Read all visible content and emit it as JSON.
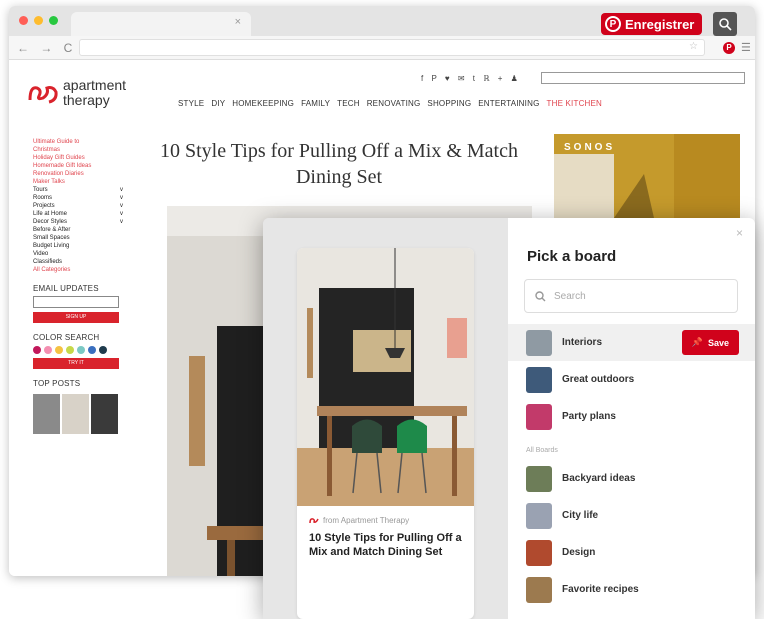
{
  "browser": {
    "tab_close": "×",
    "pinterest_button": "Enregistrer",
    "pinterest_glyph": "P",
    "nav_glyphs": "← → C"
  },
  "site": {
    "logo_line1": "apartment",
    "logo_line2": "therapy",
    "social_icons": "f P ♥ ✉ t ℝ +  ♟",
    "nav": [
      "STYLE",
      "DIY",
      "HOMEKEEPING",
      "FAMILY",
      "TECH",
      "RENOVATING",
      "SHOPPING",
      "ENTERTAINING",
      "THE KITCHEN"
    ],
    "sidebar_links": [
      "Ultimate Guide to",
      "Christmas",
      "Holiday Gift Guides",
      "Homemade Gift Ideas",
      "Renovation Diaries",
      "Maker Talks"
    ],
    "sidebar_items": [
      {
        "label": "Tours",
        "arrow": "v"
      },
      {
        "label": "Rooms",
        "arrow": "v"
      },
      {
        "label": "Projects",
        "arrow": "v"
      },
      {
        "label": "Life at Home",
        "arrow": "v"
      },
      {
        "label": "Decor Styles",
        "arrow": "v"
      },
      {
        "label": "Before & After",
        "arrow": ""
      },
      {
        "label": "Small Spaces",
        "arrow": ""
      },
      {
        "label": "Budget Living",
        "arrow": ""
      },
      {
        "label": "Video",
        "arrow": ""
      },
      {
        "label": "Classifieds",
        "arrow": ""
      }
    ],
    "all_categories": "All Categories",
    "email_heading": "EMAIL UPDATES",
    "signup_button": "SIGN UP",
    "color_heading": "COLOR SEARCH",
    "color_swatches": [
      "#c2185b",
      "#f48fb1",
      "#f5c243",
      "#c6d84a",
      "#7cc9c4",
      "#3a6fbf",
      "#1f3b4d"
    ],
    "tryit_button": "TRY IT",
    "top_posts_heading": "TOP POSTS",
    "article_title": "10 Style Tips for Pulling Off a Mix & Match Dining Set",
    "ad_brand": "SONOS"
  },
  "modal": {
    "close": "×",
    "title": "Pick a board",
    "search_placeholder": "Search",
    "pin_source": "from Apartment Therapy",
    "pin_title": "10 Style Tips for Pulling Off a Mix and Match Dining Set",
    "save_label": "Save",
    "all_boards_label": "All Boards",
    "top_boards": [
      {
        "name": "Interiors",
        "color": "#8f9aa3"
      },
      {
        "name": "Great outdoors",
        "color": "#3e5a7a"
      },
      {
        "name": "Party plans",
        "color": "#c23a6a"
      }
    ],
    "all_boards": [
      {
        "name": "Backyard ideas",
        "color": "#6d7d58"
      },
      {
        "name": "City life",
        "color": "#9aa2b2"
      },
      {
        "name": "Design",
        "color": "#b04a2e"
      },
      {
        "name": "Favorite recipes",
        "color": "#9c7a4f"
      }
    ]
  },
  "colors": {
    "accent": "#d0021b",
    "site_link": "#e0454e"
  }
}
